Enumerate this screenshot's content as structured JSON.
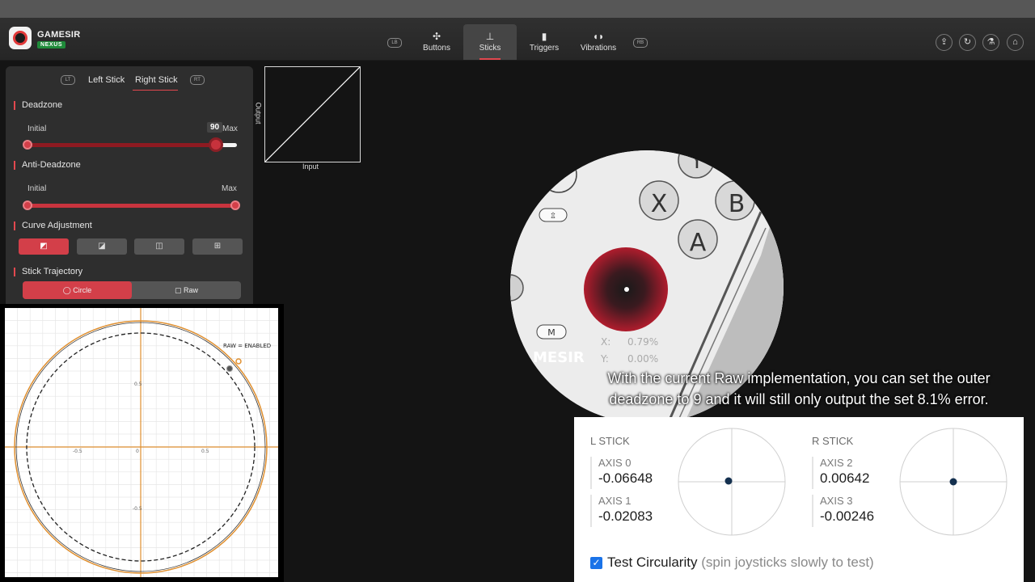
{
  "header": {
    "brand": "GAMESIR",
    "brand_sub": "NEXUS",
    "lb": "LB",
    "rb": "RB",
    "tabs": [
      {
        "label": "Buttons",
        "icon": "buttons-icon"
      },
      {
        "label": "Sticks",
        "icon": "sticks-icon",
        "active": true
      },
      {
        "label": "Triggers",
        "icon": "triggers-icon"
      },
      {
        "label": "Vibrations",
        "icon": "vibrations-icon"
      }
    ],
    "actions": [
      "upload-icon",
      "reset-icon",
      "lab-icon",
      "home-icon"
    ]
  },
  "panel": {
    "lt": "LT",
    "rt": "RT",
    "left_stick": "Left Stick",
    "right_stick": "Right Stick",
    "deadzone": {
      "title": "Deadzone",
      "initial": "Initial",
      "max": "Max",
      "value": "90",
      "level": 0.9
    },
    "anti_deadzone": {
      "title": "Anti-Deadzone",
      "initial": "Initial",
      "max": "Max",
      "level": 1.0
    },
    "curve": {
      "title": "Curve Adjustment",
      "selected": 0,
      "options": [
        "linear-curve-icon",
        "convex-curve-icon",
        "concave-curve-icon",
        "custom-curve-icon"
      ]
    },
    "trajectory": {
      "title": "Stick Trajectory",
      "circle": "Circle",
      "raw": "Raw",
      "selected": "Circle"
    }
  },
  "graph": {
    "output_label": "Output",
    "input_label": "Input"
  },
  "magnifier": {
    "buttons": [
      "X",
      "B",
      "A",
      "Y",
      "M"
    ],
    "x_label": "X:",
    "x_value": "0.79%",
    "y_label": "Y:",
    "y_value": "0.00%",
    "brand_fragment": "MESIR"
  },
  "caption": {
    "line1": "With the current Raw implementation, you can set the outer",
    "line2": "deadzone to 9 and it will still only output the set 8.1% error."
  },
  "tester": {
    "l_stick": "L STICK",
    "r_stick": "R STICK",
    "axes": [
      {
        "name": "AXIS 0",
        "value": "-0.06648"
      },
      {
        "name": "AXIS 1",
        "value": "-0.02083"
      },
      {
        "name": "AXIS 2",
        "value": "0.00642"
      },
      {
        "name": "AXIS 3",
        "value": "-0.00246"
      }
    ],
    "check_label": "Test Circularity",
    "check_hint": "(spin joysticks slowly to test)"
  },
  "circularity": {
    "raw_label": "RAW = ENABLED",
    "ticks": {
      "pos": "0.5",
      "neg": "-0.5",
      "zero": "0"
    },
    "accent": "#e09030"
  }
}
